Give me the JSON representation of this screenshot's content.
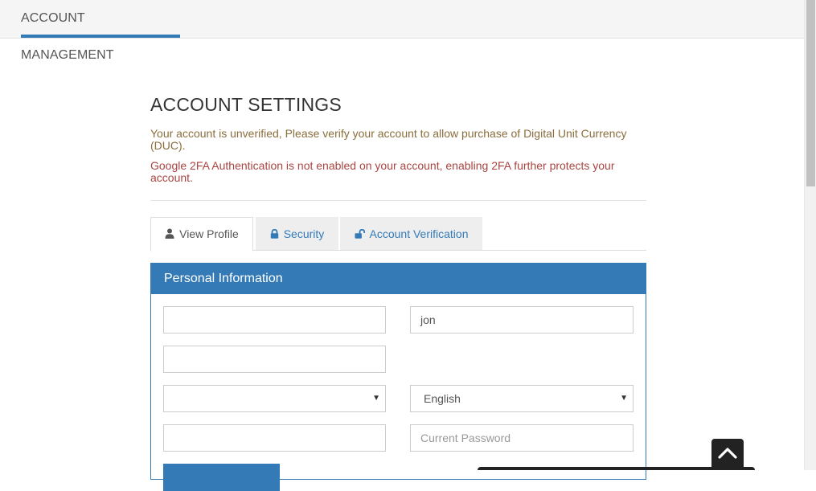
{
  "header": {
    "active_tab_label": "ACCOUNT MANAGEMENT"
  },
  "page": {
    "title": "ACCOUNT SETTINGS",
    "notice_unverified": "Your account is unverified, Please verify your account to allow purchase of Digital Unit Currency (DUC).",
    "notice_2fa": "Google 2FA Authentication is not enabled on your account, enabling 2FA further protects your account."
  },
  "tabs": [
    {
      "label": "View Profile",
      "icon": "user-icon",
      "active": true
    },
    {
      "label": "Security",
      "icon": "lock-icon",
      "active": false
    },
    {
      "label": "Account Verification",
      "icon": "unlock-icon",
      "active": false
    }
  ],
  "panel": {
    "heading": "Personal Information",
    "fields": {
      "first_value": "",
      "username_value": "jon",
      "third_value": "",
      "select_left_value": "",
      "language_value": "English",
      "bottom_left_value": "",
      "password_placeholder": "Current Password"
    },
    "save_label": ""
  },
  "colors": {
    "brand": "#337ab7",
    "warning_text": "#8a6d3b",
    "danger_text": "#a94442"
  },
  "icons": {
    "back_to_top": "chevron-up-icon"
  }
}
